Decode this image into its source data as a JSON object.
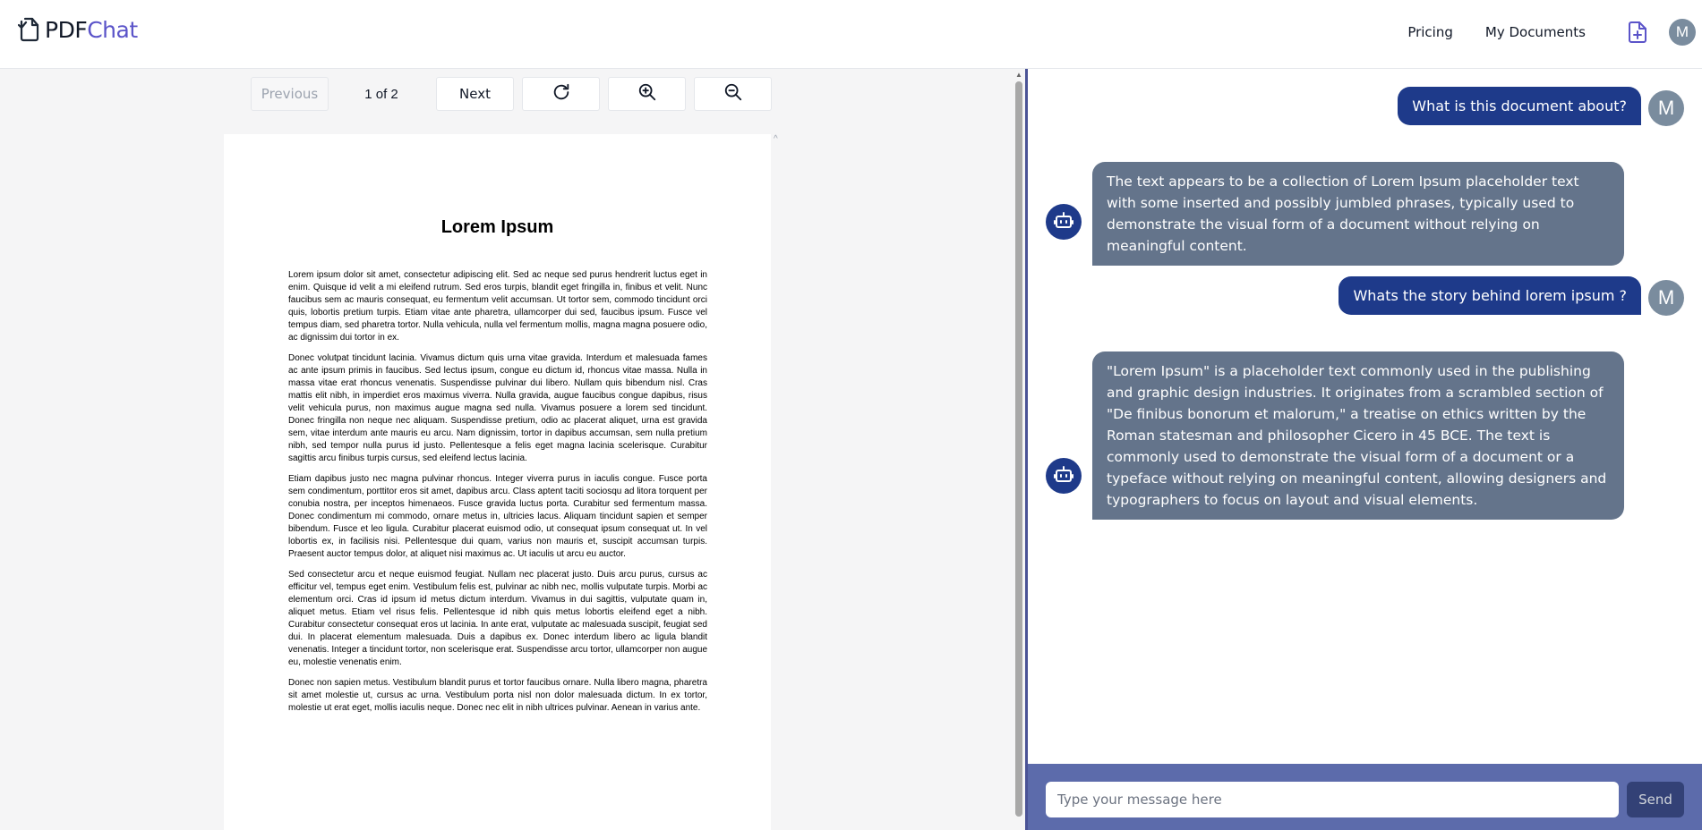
{
  "header": {
    "logo_prefix": "PDF",
    "logo_accent": "Chat",
    "nav": {
      "pricing": "Pricing",
      "my_documents": "My Documents"
    },
    "upload_icon": "file-plus-icon",
    "avatar_initial": "M"
  },
  "viewer": {
    "previous_label": "Previous",
    "page_indicator": "1 of 2",
    "next_label": "Next",
    "icons": [
      "rotate-icon",
      "zoom-in-icon",
      "zoom-out-icon"
    ],
    "document": {
      "title": "Lorem Ipsum",
      "paragraphs": [
        "Lorem ipsum dolor sit amet, consectetur adipiscing elit. Sed ac neque sed purus hendrerit luctus eget in enim. Quisque id velit a mi eleifend rutrum. Sed eros turpis, blandit eget fringilla in, finibus et velit. Nunc faucibus sem ac mauris consequat, eu fermentum velit accumsan. Ut tortor sem, commodo tincidunt orci quis, lobortis pretium turpis. Etiam vitae ante pharetra, ullamcorper dui sed, faucibus ipsum. Fusce vel tempus diam, sed pharetra tortor. Nulla vehicula, nulla vel fermentum mollis, magna magna posuere odio, ac dignissim dui tortor in ex.",
        "Donec volutpat tincidunt lacinia. Vivamus dictum quis urna vitae gravida. Interdum et malesuada fames ac ante ipsum primis in faucibus. Sed lectus ipsum, congue eu dictum id, rhoncus vitae massa. Nulla in massa vitae erat rhoncus venenatis. Suspendisse pulvinar dui libero. Nullam quis bibendum nisl. Cras mattis elit nibh, in imperdiet eros maximus viverra. Nulla gravida, augue faucibus congue dapibus, risus velit vehicula purus, non maximus augue magna sed nulla. Vivamus posuere a lorem sed tincidunt. Donec fringilla non neque nec aliquam. Suspendisse pretium, odio ac placerat aliquet, urna est gravida sem, vitae interdum ante mauris eu arcu. Nam dignissim, tortor in dapibus accumsan, sem nulla pretium nibh, sed tempor nulla purus id justo. Pellentesque a felis eget magna lacinia scelerisque. Curabitur sagittis arcu finibus turpis cursus, sed eleifend lectus lacinia.",
        "Etiam dapibus justo nec magna pulvinar rhoncus. Integer viverra purus in iaculis congue. Fusce porta sem condimentum, porttitor eros sit amet, dapibus arcu. Class aptent taciti sociosqu ad litora torquent per conubia nostra, per inceptos himenaeos. Fusce gravida luctus porta. Curabitur sed fermentum massa. Donec condimentum mi commodo, ornare metus in, ultricies lacus. Aliquam tincidunt sapien et semper bibendum. Fusce et leo ligula. Curabitur placerat euismod odio, ut consequat ipsum consequat ut. In vel lobortis ex, in facilisis nisi. Pellentesque dui quam, varius non mauris et, suscipit accumsan turpis. Praesent auctor tempus dolor, at aliquet nisi maximus ac. Ut iaculis ut arcu eu auctor.",
        "Sed consectetur arcu et neque euismod feugiat. Nullam nec placerat justo. Duis arcu purus, cursus ac efficitur vel, tempus eget enim. Vestibulum felis est, pulvinar ac nibh nec, mollis vulputate turpis. Morbi ac elementum orci. Cras id ipsum id metus dictum interdum. Vivamus in dui sagittis, vulputate quam in, aliquet metus. Etiam vel risus felis. Pellentesque id nibh quis metus lobortis eleifend eget a nibh. Curabitur consectetur consequat eros ut lacinia. In ante erat, vulputate ac malesuada suscipit, feugiat sed dui. In placerat elementum malesuada. Duis a dapibus ex. Donec interdum libero ac ligula blandit venenatis. Integer a tincidunt tortor, non scelerisque erat. Suspendisse arcu tortor, ullamcorper non augue eu, molestie venenatis enim.",
        "Donec non sapien metus. Vestibulum blandit purus et tortor faucibus ornare. Nulla libero magna, pharetra sit amet molestie ut, cursus ac urna. Vestibulum porta nisl non dolor malesuada dictum. In ex tortor, molestie ut erat eget, mollis iaculis neque. Donec nec elit in nibh ultrices pulvinar. Aenean in varius ante."
      ]
    }
  },
  "chat": {
    "messages": [
      {
        "role": "user",
        "avatar": "M",
        "text": "What is this document about?"
      },
      {
        "role": "bot",
        "avatar_icon": "robot-icon",
        "text": "The text appears to be a collection of Lorem Ipsum placeholder text with some inserted and possibly jumbled phrases, typically used to demonstrate the visual form of a document without relying on meaningful content."
      },
      {
        "role": "user",
        "avatar": "M",
        "text": "Whats the story behind lorem ipsum ?"
      },
      {
        "role": "bot",
        "avatar_icon": "robot-icon",
        "text": "\"Lorem Ipsum\" is a placeholder text commonly used in the publishing and graphic design industries. It originates from a scrambled section of \"De finibus bonorum et malorum,\" a treatise on ethics written by the Roman statesman and philosopher Cicero in 45 BCE. The text is commonly used to demonstrate the visual form of a document or a typeface without relying on meaningful content, allowing designers and typographers to focus on layout and visual elements."
      }
    ],
    "input_placeholder": "Type your message here",
    "input_value": "",
    "send_label": "Send"
  },
  "colors": {
    "user_bubble": "#1e3a8a",
    "bot_bubble": "#64748b",
    "input_bar": "#5c6bab",
    "divider": "#4a5396",
    "logo_accent": "#5b54c9"
  }
}
